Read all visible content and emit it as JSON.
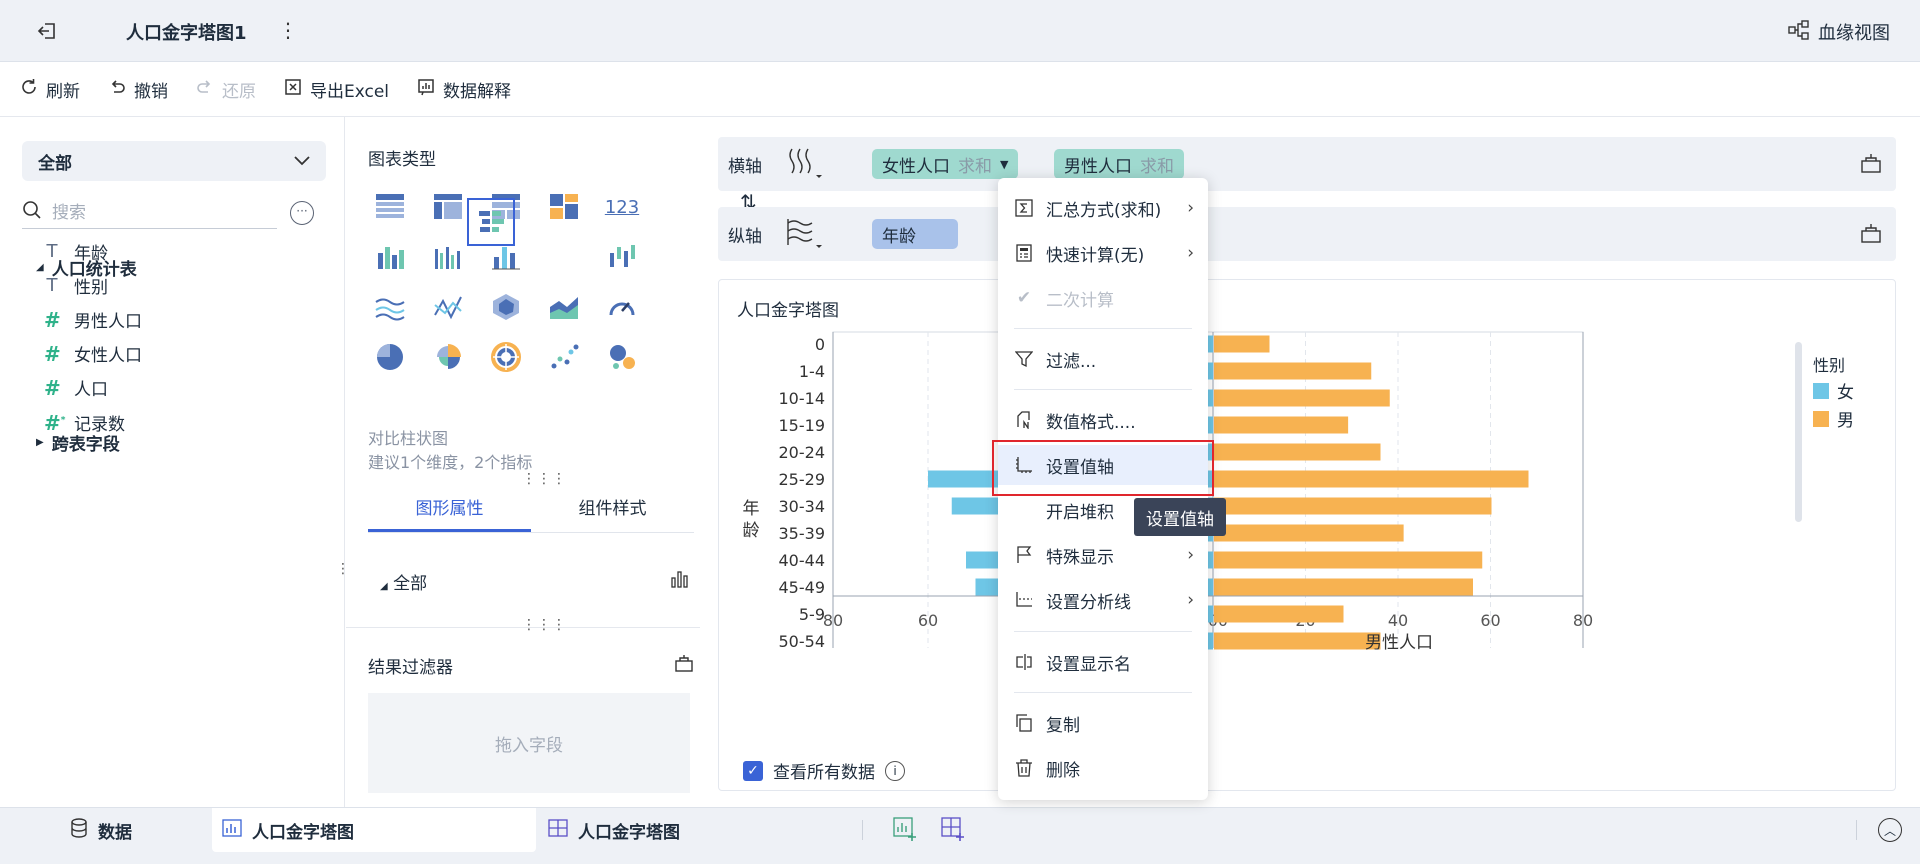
{
  "header": {
    "tab_title": "人口金字塔图1",
    "lineage_label": "血缘视图"
  },
  "toolbar": {
    "refresh": "刷新",
    "undo": "撤销",
    "redo": "还原",
    "export": "导出Excel",
    "explain": "数据解释"
  },
  "left": {
    "dataset": "全部",
    "search_placeholder": "搜索",
    "table_name": "人口统计表",
    "fields": [
      {
        "type": "text",
        "label": "年龄"
      },
      {
        "type": "text",
        "label": "性别"
      },
      {
        "type": "number",
        "label": "男性人口"
      },
      {
        "type": "number",
        "label": "女性人口"
      },
      {
        "type": "number",
        "label": "人口"
      },
      {
        "type": "calc",
        "label": "记录数"
      }
    ],
    "cross_fields": "跨表字段"
  },
  "middle": {
    "chart_type_title": "图表类型",
    "recommend_title": "对比柱状图",
    "recommend_tip": "建议1个维度，2个指标",
    "tabs": [
      "图形属性",
      "组件样式"
    ],
    "all_label": "全部",
    "result_filter": "结果过滤器",
    "drop_zone": "拖入字段"
  },
  "axes": {
    "x_label": "横轴",
    "y_label": "纵轴",
    "x_pills": [
      {
        "name": "女性人口",
        "agg": "求和"
      },
      {
        "name": "男性人口",
        "agg": "求和"
      }
    ],
    "y_pills": [
      {
        "name": "年龄"
      }
    ]
  },
  "chart": {
    "title": "人口金字塔图",
    "view_all": "查看所有数据",
    "legend_title": "性别"
  },
  "chart_data": {
    "type": "bar",
    "title": "人口金字塔图",
    "ylabel": "年龄",
    "xlabel": "男性人口",
    "categories": [
      "0",
      "1-4",
      "10-14",
      "15-19",
      "20-24",
      "25-29",
      "30-34",
      "35-39",
      "40-44",
      "45-49",
      "5-9",
      "50-54"
    ],
    "series": [
      {
        "name": "女",
        "color": "#6ec6e6",
        "values": [
          20,
          30,
          35,
          25,
          33,
          60,
          55,
          38,
          52,
          50,
          16,
          34
        ]
      },
      {
        "name": "男",
        "color": "#f7b251",
        "values": [
          12,
          34,
          38,
          29,
          36,
          68,
          60,
          41,
          58,
          56,
          28,
          36
        ]
      }
    ],
    "xlim_left": [
      80,
      0
    ],
    "xlim_right": [
      0,
      80
    ],
    "left_ticks": [
      "80",
      "60",
      "40",
      "20",
      "0"
    ],
    "right_ticks": [
      "0",
      "20",
      "40",
      "60",
      "80"
    ],
    "legend_position": "right"
  },
  "context_menu": {
    "items": [
      {
        "label": "汇总方式(求和)",
        "icon": "sigma-icon",
        "submenu": true,
        "disabled": false
      },
      {
        "label": "快速计算(无)",
        "icon": "calculator-icon",
        "submenu": true,
        "disabled": false
      },
      {
        "label": "二次计算",
        "icon": "check-icon",
        "submenu": false,
        "disabled": true
      },
      {
        "label": "过滤...",
        "icon": "filter-icon",
        "submenu": false,
        "disabled": false
      },
      {
        "label": "数值格式....",
        "icon": "number-format-icon",
        "submenu": false,
        "disabled": false
      },
      {
        "label": "设置值轴",
        "icon": "value-axis-icon",
        "submenu": false,
        "disabled": false
      },
      {
        "label": "开启堆积",
        "icon": "",
        "submenu": false,
        "disabled": false
      },
      {
        "label": "特殊显示",
        "icon": "flag-icon",
        "submenu": true,
        "disabled": false
      },
      {
        "label": "设置分析线",
        "icon": "analysis-line-icon",
        "submenu": true,
        "disabled": false
      },
      {
        "label": "设置显示名",
        "icon": "rename-icon",
        "submenu": false,
        "disabled": false
      },
      {
        "label": "复制",
        "icon": "copy-icon",
        "submenu": false,
        "disabled": false
      },
      {
        "label": "删除",
        "icon": "trash-icon",
        "submenu": false,
        "disabled": false
      }
    ],
    "tooltip": "设置值轴"
  },
  "bottom": {
    "data_tab": "数据",
    "tab1": "人口金字塔图",
    "tab2": "人口金字塔图"
  }
}
